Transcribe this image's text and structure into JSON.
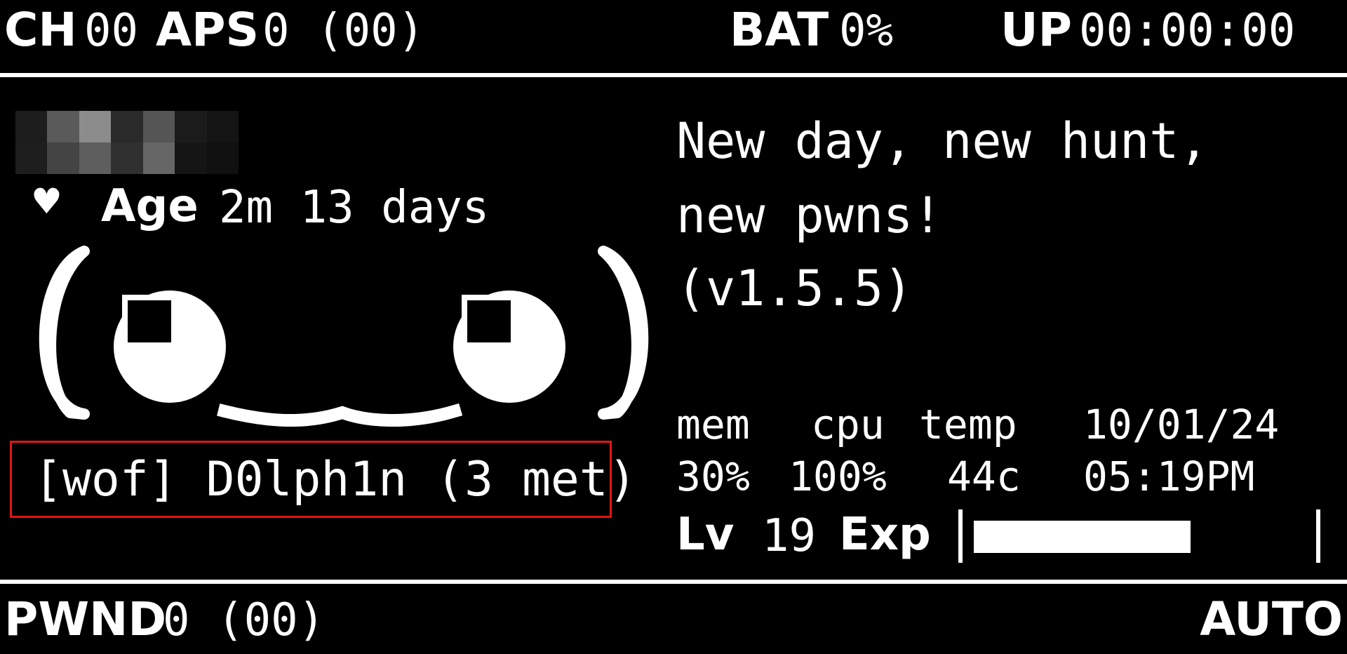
{
  "top_bar": {
    "channel_label": "CH",
    "channel_value": "00",
    "aps_label": "APS",
    "aps_value": "0 (00)",
    "battery_label": "BAT",
    "battery_value": "0%",
    "uptime_label": "UP",
    "uptime_value": "00:00:00"
  },
  "status": {
    "age_icon": "heart-icon",
    "age_label": "Age",
    "age_value": "2m 13 days",
    "message_line1": "New day, new hunt,",
    "message_line2": "new pwns!",
    "message_line3": "(v1.5.5)"
  },
  "peer": {
    "text": "[wof] D0lph1n (3 met)",
    "highlight_color": "#e01616"
  },
  "stats": {
    "headers": [
      "mem",
      "cpu",
      "temp"
    ],
    "values": [
      "30%",
      "100%",
      "44c"
    ],
    "date": "10/01/24",
    "time": "05:19PM"
  },
  "level": {
    "lv_label": "Lv",
    "lv_value": "19",
    "exp_label": "Exp",
    "exp_fill_fraction": 0.63
  },
  "bottom_bar": {
    "pwnd_label": "PWND",
    "pwnd_value": "0 (00)",
    "mode": "AUTO"
  },
  "pixel_name_colors": [
    [
      "#1d1d1d",
      "#5a5a5a",
      "#8c8c8c",
      "#2a2a2a",
      "#555555",
      "#1b1b1b",
      "#141414"
    ],
    [
      "#1e1e1e",
      "#444444",
      "#5e5e5e",
      "#303030",
      "#666666",
      "#151515",
      "#101010"
    ]
  ]
}
